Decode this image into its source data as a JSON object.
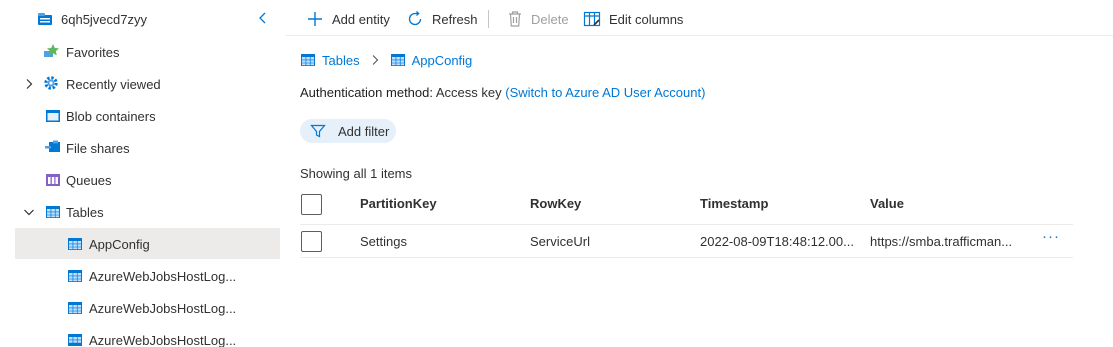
{
  "sidebar": {
    "account": "6qh5jvecd7zyy",
    "items": [
      {
        "label": "Favorites"
      },
      {
        "label": "Recently viewed"
      },
      {
        "label": "Blob containers"
      },
      {
        "label": "File shares"
      },
      {
        "label": "Queues"
      },
      {
        "label": "Tables"
      },
      {
        "label": "AppConfig"
      },
      {
        "label": "AzureWebJobsHostLog..."
      },
      {
        "label": "AzureWebJobsHostLog..."
      },
      {
        "label": "AzureWebJobsHostLog..."
      }
    ]
  },
  "toolbar": {
    "add_entity": "Add entity",
    "refresh": "Refresh",
    "delete": "Delete",
    "edit_columns": "Edit columns"
  },
  "breadcrumb": {
    "tables": "Tables",
    "current": "AppConfig"
  },
  "auth": {
    "label": "Authentication method:",
    "value": "Access key",
    "switch_link": "(Switch to Azure AD User Account)"
  },
  "filter": {
    "label": "Add filter"
  },
  "list": {
    "showing": "Showing all 1 items",
    "columns": [
      "PartitionKey",
      "RowKey",
      "Timestamp",
      "Value"
    ],
    "rows": [
      {
        "partition_key": "Settings",
        "row_key": "ServiceUrl",
        "timestamp": "2022-08-09T18:48:12.00...",
        "value": "https://smba.trafficman...",
        "more": "···"
      }
    ]
  },
  "colors": {
    "accent": "#0078d4",
    "selected_bg": "#edebe9",
    "filter_bg": "#e6f0fa"
  }
}
